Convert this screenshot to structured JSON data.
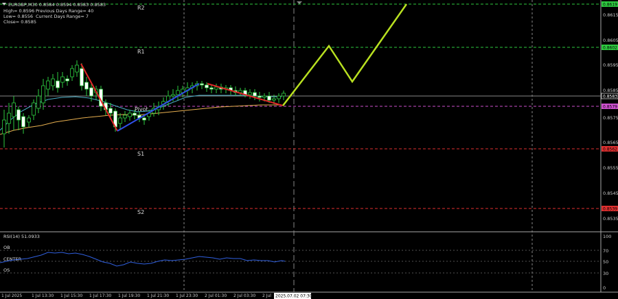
{
  "header": {
    "symbol_line": "EURGBP,M30  0.8584 0.8594 0.8583 0.8583",
    "high": "High= 0.8596",
    "low": "Low= 0.8556",
    "close": "Close= 0.8585",
    "prev_range": "Previous Days Range= 40",
    "cur_range": "Current Days Range= 7"
  },
  "levels": {
    "r2": {
      "label": "R2",
      "price": "0.8619",
      "color": "#2ecc40"
    },
    "r1": {
      "label": "R1",
      "price": "0.8602",
      "color": "#2ecc40"
    },
    "pivot": {
      "label": "Pivot",
      "price": "0.8579",
      "color": "#d050d0"
    },
    "s1": {
      "label": "S1",
      "price": "0.8562",
      "color": "#e03030"
    },
    "s2": {
      "label": "S2",
      "price": "0.8539",
      "color": "#e03030"
    }
  },
  "price_ticks": [
    "0.8615",
    "0.8605",
    "0.8595",
    "0.8585",
    "0.8575",
    "0.8565",
    "0.8555",
    "0.8545",
    "0.8535"
  ],
  "current_price": "0.8583",
  "rsi": {
    "title": "RSI(14) 51.0933",
    "ob": "OB",
    "center": "CENTER",
    "os": "OS",
    "ticks": [
      "100",
      "70",
      "50",
      "30",
      "0"
    ]
  },
  "time_ticks": [
    "1 Jul 2025",
    "1 Jul 13:30",
    "1 Jul 15:30",
    "1 Jul 17:30",
    "1 Jul 19:30",
    "1 Jul 21:30",
    "1 Jul 23:30",
    "2 Jul 01:30",
    "2 Jul 03:30",
    "2 Jul"
  ],
  "time_cursor": "2025.07.02 07:30",
  "colors": {
    "bull": "#ffffff",
    "bear": "#ffffff",
    "candle_border": "#2ecc40",
    "ma_fast": "#4ab0c8",
    "ma_slow": "#e8b050",
    "wave_red": "#e02828",
    "wave_blue": "#3050e8",
    "projection": "#b8e020",
    "rsi_line": "#3060e0"
  }
}
